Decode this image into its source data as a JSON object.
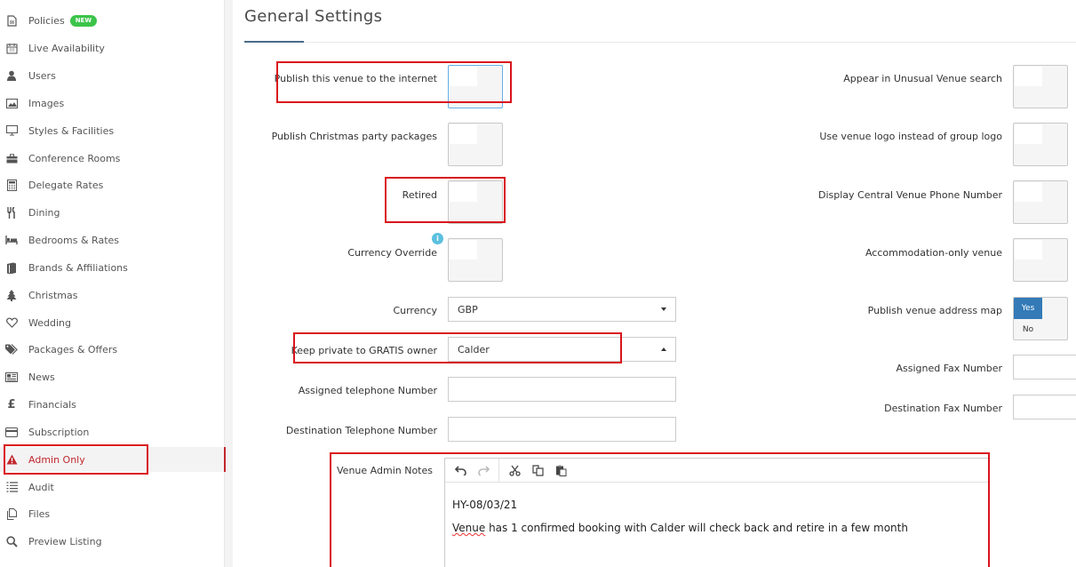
{
  "sidebar": {
    "items": [
      {
        "label": "Policies",
        "icon": "document-icon",
        "badge": "NEW"
      },
      {
        "label": "Live Availability",
        "icon": "calendar-icon"
      },
      {
        "label": "Users",
        "icon": "user-icon"
      },
      {
        "label": "Images",
        "icon": "image-icon"
      },
      {
        "label": "Styles & Facilities",
        "icon": "monitor-icon"
      },
      {
        "label": "Conference Rooms",
        "icon": "briefcase-icon"
      },
      {
        "label": "Delegate Rates",
        "icon": "calculator-icon"
      },
      {
        "label": "Dining",
        "icon": "cutlery-icon"
      },
      {
        "label": "Bedrooms & Rates",
        "icon": "bed-icon"
      },
      {
        "label": "Brands & Affiliations",
        "icon": "book-icon"
      },
      {
        "label": "Christmas",
        "icon": "tree-icon"
      },
      {
        "label": "Wedding",
        "icon": "heart-icon"
      },
      {
        "label": "Packages & Offers",
        "icon": "tags-icon"
      },
      {
        "label": "News",
        "icon": "newspaper-icon"
      },
      {
        "label": "Financials",
        "icon": "pound-icon"
      },
      {
        "label": "Subscription",
        "icon": "credit-card-icon"
      },
      {
        "label": "Admin Only",
        "icon": "warning-icon",
        "active": true
      },
      {
        "label": "Audit",
        "icon": "list-icon"
      },
      {
        "label": "Files",
        "icon": "files-icon"
      },
      {
        "label": "Preview Listing",
        "icon": "search-icon"
      }
    ]
  },
  "main": {
    "title": "General Settings",
    "left_fields": {
      "publish_venue": "Publish this venue to the internet",
      "publish_christmas": "Publish Christmas party packages",
      "retired": "Retired",
      "currency_override": "Currency Override",
      "currency": "Currency",
      "currency_value": "GBP",
      "keep_private": "Keep private to GRATIS owner",
      "keep_private_value": "Calder",
      "assigned_tel": "Assigned telephone Number",
      "destination_tel": "Destination Telephone Number",
      "venue_admin_notes": "Venue Admin Notes"
    },
    "right_fields": {
      "unusual_search": "Appear in Unusual Venue search",
      "venue_logo": "Use venue logo instead of group logo",
      "central_phone": "Display Central Venue Phone Number",
      "accommodation_only": "Accommodation-only venue",
      "address_map": "Publish venue address map",
      "address_map_yes": "Yes",
      "address_map_no": "No",
      "assigned_fax": "Assigned Fax Number",
      "destination_fax": "Destination Fax Number"
    },
    "info_icon": "i",
    "notes": {
      "line1": "HY-08/03/21",
      "line2_misspelled": "Venue",
      "line2_rest": " has 1 confirmed booking with Calder will check back and retire in a few month"
    }
  },
  "colors": {
    "highlight_red": "#d9141c",
    "accent_blue": "#337ab7",
    "active_red": "#c2272d"
  }
}
